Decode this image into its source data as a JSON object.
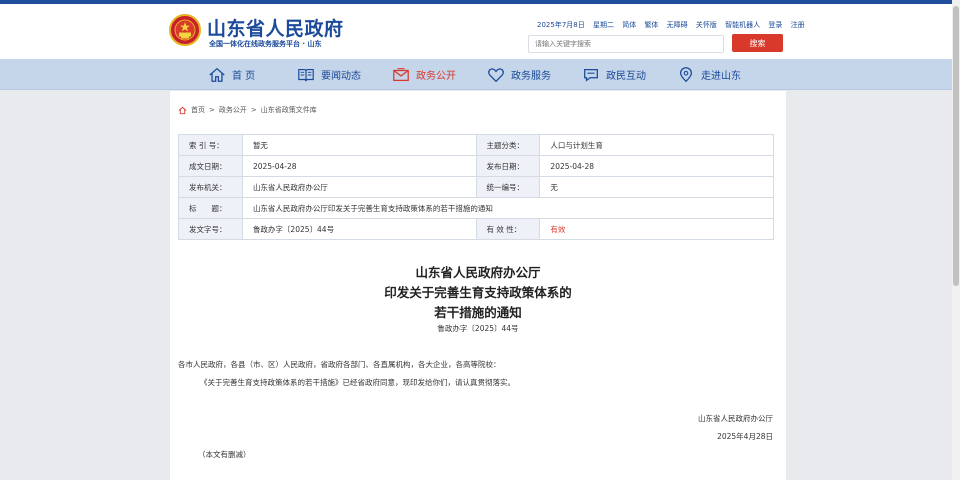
{
  "header": {
    "title": "山东省人民政府",
    "subtitle": "全国一体化在线政务服务平台 · 山东",
    "util_links": [
      "2025年7月8日",
      "星期二",
      "简体",
      "繁体",
      "无障碍",
      "关怀版",
      "智能机器人",
      "登录",
      "注册"
    ],
    "search_placeholder": "请输入关键字搜索",
    "search_button": "搜索"
  },
  "nav": {
    "items": [
      {
        "label": "首 页",
        "icon": "home-icon"
      },
      {
        "label": "要闻动态",
        "icon": "book-icon"
      },
      {
        "label": "政务公开",
        "icon": "mail-icon",
        "active": true
      },
      {
        "label": "政务服务",
        "icon": "heart-icon"
      },
      {
        "label": "政民互动",
        "icon": "chat-icon"
      },
      {
        "label": "走进山东",
        "icon": "location-icon"
      }
    ]
  },
  "breadcrumb": [
    "首页",
    "政务公开",
    "山东省政策文件库"
  ],
  "meta": {
    "index_label": "索 引 号：",
    "index_value": "暂无",
    "topic_label": "主题分类：",
    "topic_value": "人口与计划生育",
    "written_label": "成文日期：",
    "written_value": "2025-04-28",
    "publish_label": "发布日期：",
    "publish_value": "2025-04-28",
    "org_label": "发布机关：",
    "org_value": "山东省人民政府办公厅",
    "serial_label": "统一编号：",
    "serial_value": "无",
    "title_label": "标　　题：",
    "title_value": "山东省人民政府办公厅印发关于完善生育支持政策体系的若干措施的通知",
    "docno_label": "发文字号：",
    "docno_value": "鲁政办字〔2025〕44号",
    "validity_label": "有 效 性：",
    "validity_value": "有效"
  },
  "document": {
    "title_lines": [
      "山东省人民政府办公厅",
      "印发关于完善生育支持政策体系的",
      "若干措施的通知"
    ],
    "doc_no": "鲁政办字〔2025〕44号",
    "recipients": "各市人民政府，各县（市、区）人民政府，省政府各部门、各直属机构，各大企业，各高等院校：",
    "body": "《关于完善生育支持政策体系的若干措施》已经省政府同意，现印发给你们，请认真贯彻落实。",
    "signature": "山东省人民政府办公厅",
    "date": "2025年4月28日",
    "note": "（本文有删减）"
  },
  "colors": {
    "brand_blue": "#1a4a99",
    "accent_red": "#d8392b",
    "nav_bg": "#c5d5ea"
  }
}
